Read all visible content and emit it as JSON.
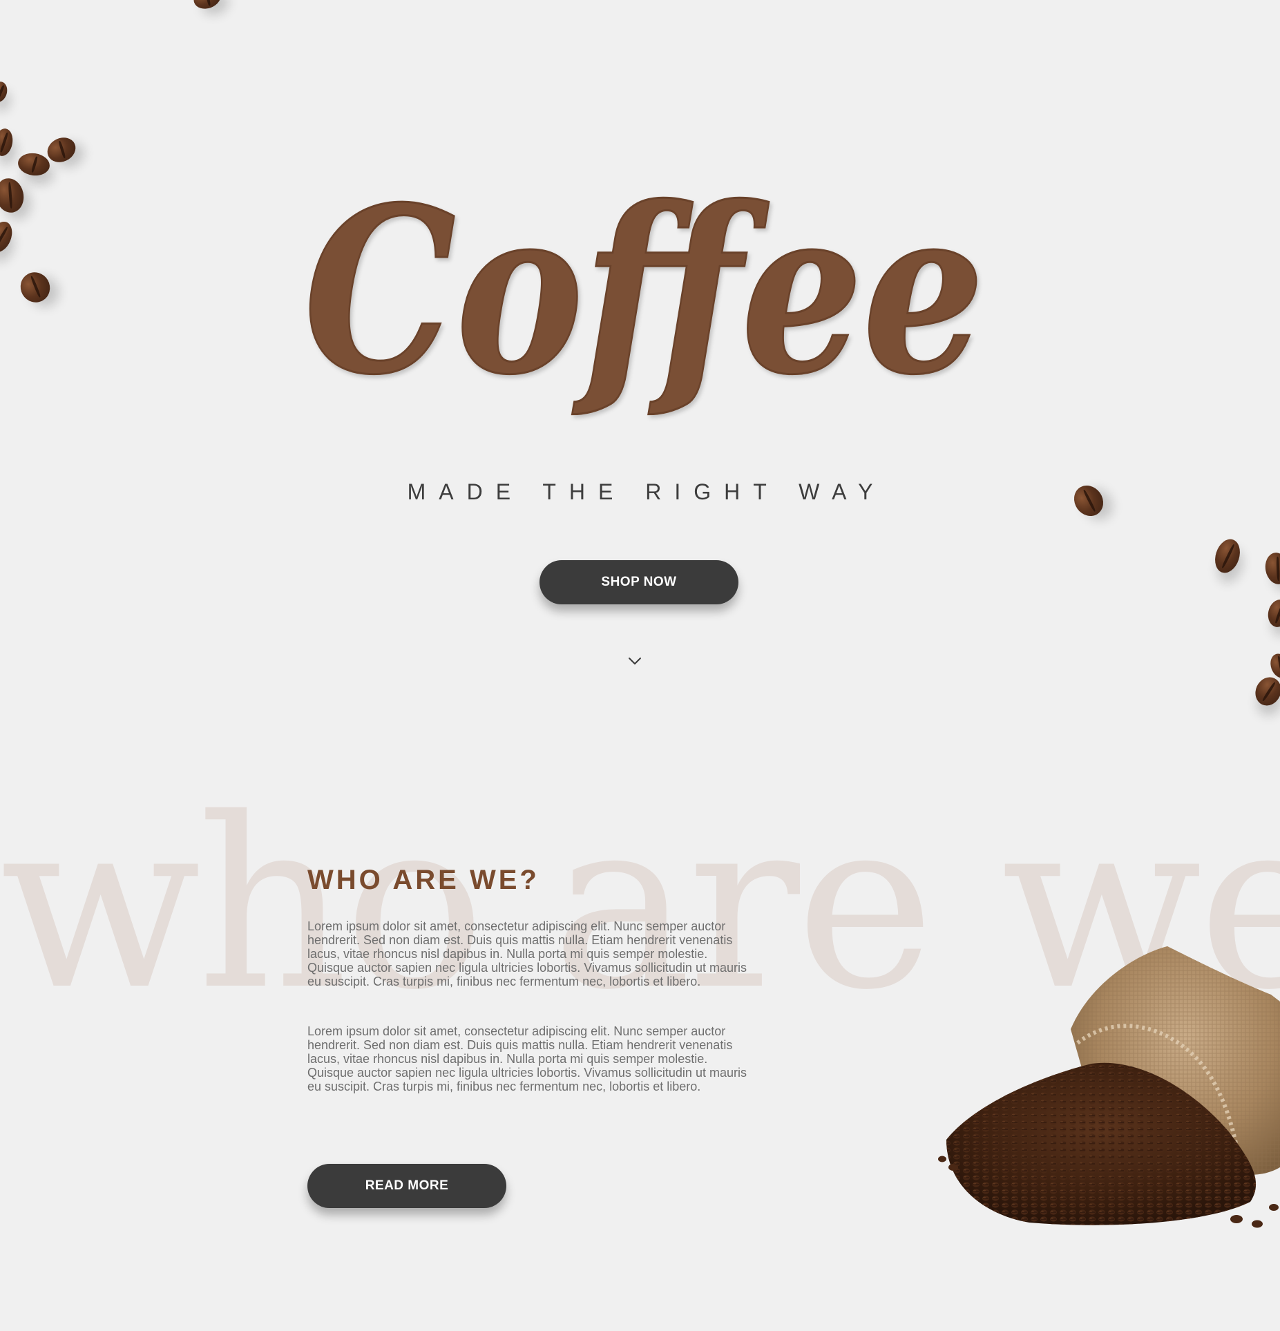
{
  "hero": {
    "title": "Coffee",
    "tagline": "MADE THE RIGHT WAY",
    "cta_label": "SHOP NOW",
    "scroll_icon": "chevron-down-icon"
  },
  "about": {
    "background_word": "who are we?",
    "heading": "WHO ARE WE?",
    "paragraphs": [
      "Lorem ipsum dolor sit amet, consectetur adipiscing elit. Nunc semper auctor hendrerit. Sed non diam est. Duis quis mattis nulla. Etiam hendrerit venenatis lacus, vitae rhoncus nisl dapibus in. Nulla porta mi quis semper molestie. Quisque auctor sapien nec ligula ultricies lobortis. Vivamus sollicitudin ut mauris eu suscipit. Cras turpis mi, finibus nec fermentum nec, lobortis et libero.",
      "Lorem ipsum dolor sit amet, consectetur adipiscing elit. Nunc semper auctor hendrerit. Sed non diam est. Duis quis mattis nulla. Etiam hendrerit venenatis lacus, vitae rhoncus nisl dapibus in. Nulla porta mi quis semper molestie. Quisque auctor sapien nec ligula ultricies lobortis. Vivamus sollicitudin ut mauris eu suscipit. Cras turpis mi, finibus nec fermentum nec, lobortis et libero."
    ],
    "cta_label": "READ MORE"
  },
  "colors": {
    "background": "#f0f0f0",
    "brand_brown": "#7a4f36",
    "heading_brown": "#7a4b2e",
    "button_dark": "#3b3b3b",
    "watermark": "#e4dcd8",
    "body_text": "#6e6e6e"
  },
  "decor": {
    "bean_image": "coffee-bean-icon",
    "sack_image": "coffee-sack-image"
  }
}
